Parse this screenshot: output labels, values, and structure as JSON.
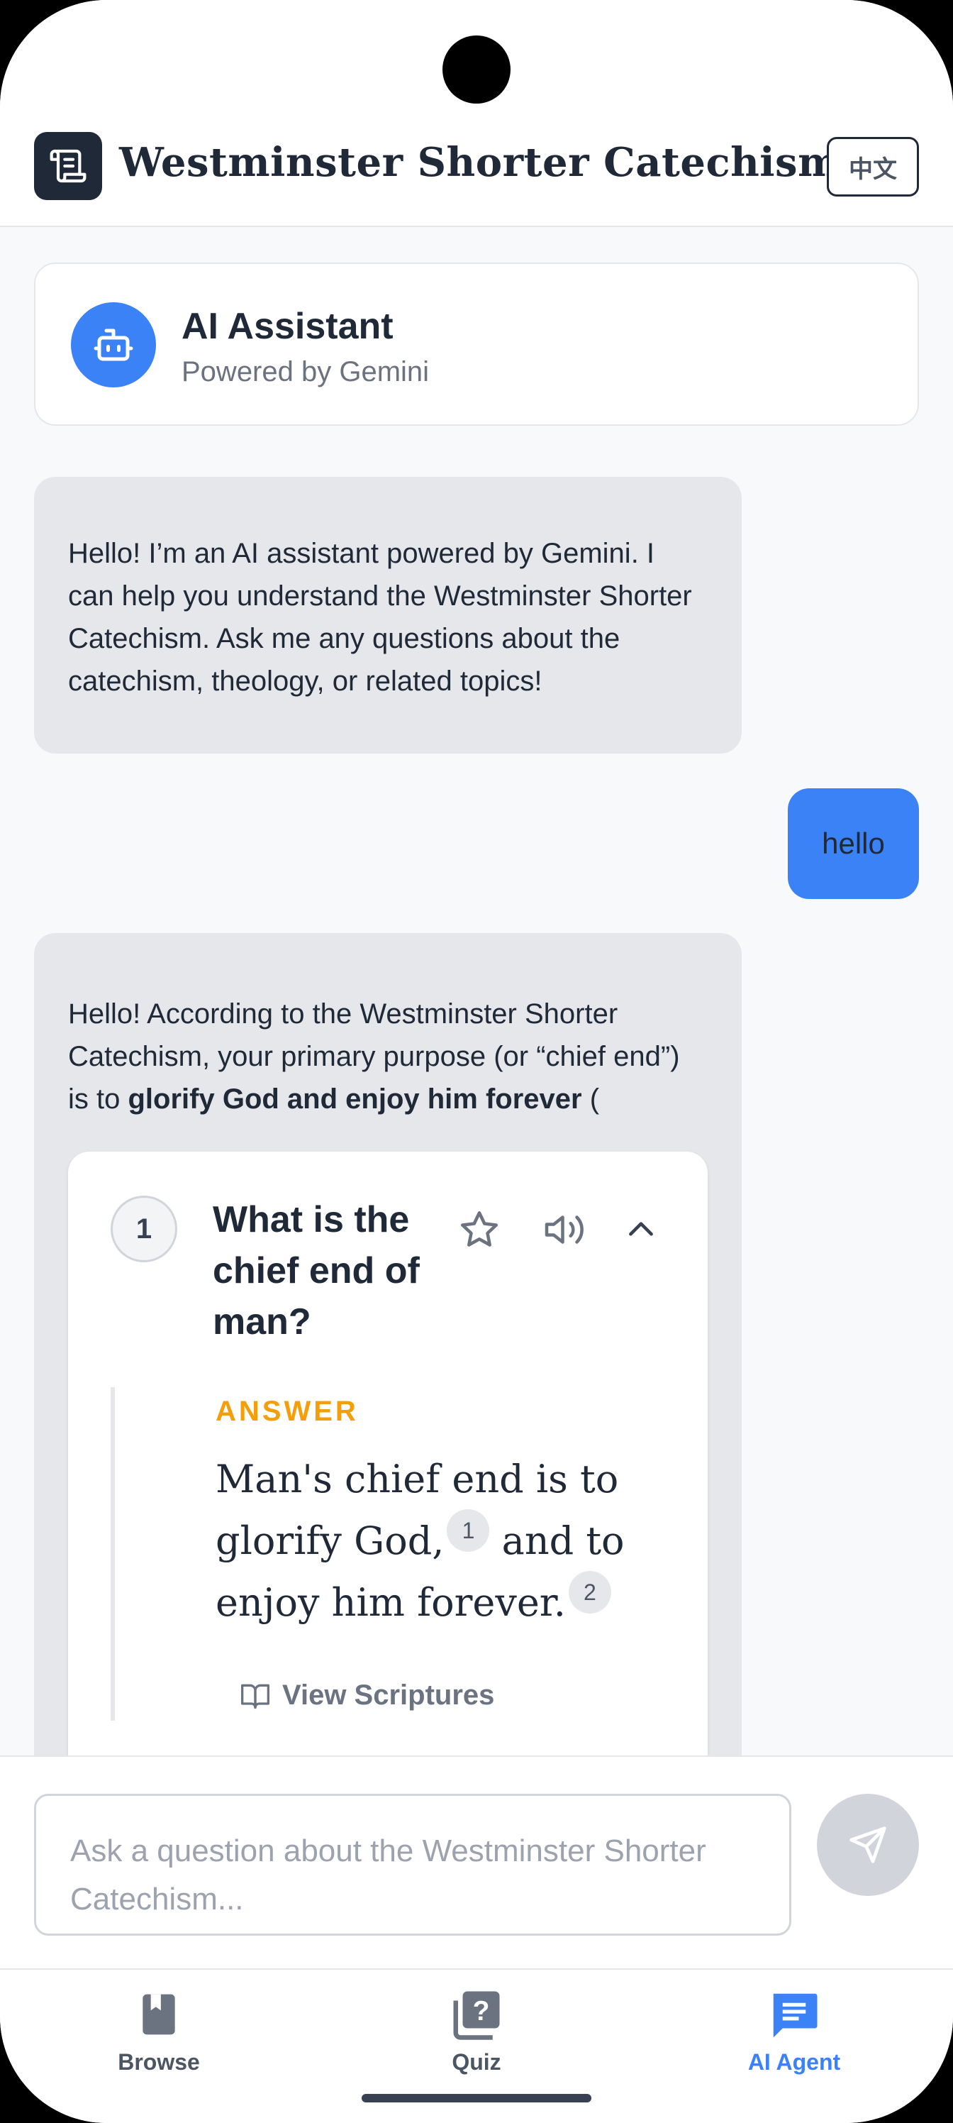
{
  "header": {
    "title": "Westminster Shorter Catechism",
    "lang_button": "中文"
  },
  "assistant_card": {
    "name": "AI Assistant",
    "subtitle": "Powered by Gemini"
  },
  "messages": {
    "ai_greeting": "Hello! I’m an AI assistant powered by Gemini. I can help you understand the Westminster Shorter Catechism. Ask me any questions about the catechism, theology, or related topics!",
    "user_message": "hello",
    "ai_reply_prefix": "Hello! According to the Westminster Shorter Catechism, your primary purpose (or “chief end”) is to ",
    "ai_reply_bold": "glorify God and enjoy him forever",
    "ai_reply_suffix": " ("
  },
  "question_card": {
    "number": "1",
    "question": "What is the chief end of man?",
    "answer_label": "ANSWER",
    "answer_part1": "Man's chief end is to glorify God,",
    "footnote1": "1",
    "answer_part2": " and to enjoy him forever.",
    "footnote2": "2",
    "view_scriptures": "View Scriptures"
  },
  "input": {
    "placeholder": "Ask a question about the Westminster Shorter Catechism..."
  },
  "nav": {
    "browse": "Browse",
    "quiz": "Quiz",
    "ai_agent": "AI Agent",
    "active": "ai_agent"
  },
  "colors": {
    "accent": "#3b82f6",
    "answer_label": "#f59e0b",
    "bubble_ai": "#e5e7eb",
    "header_dark": "#1f2937"
  }
}
